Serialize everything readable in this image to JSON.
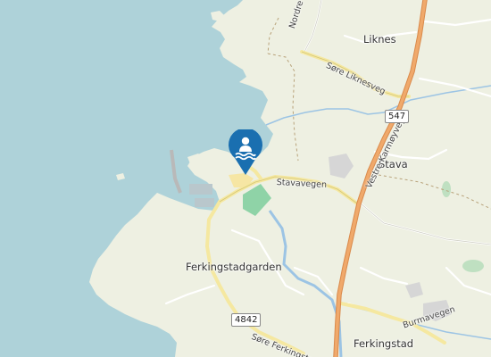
{
  "map": {
    "places": {
      "liknes": "Liknes",
      "stava": "Stava",
      "ferkingstadgarden": "Ferkingstadgarden",
      "ferkingstad": "Ferkingstad"
    },
    "roads": {
      "nordre_liknes": "Nordre Likne",
      "sore_liknesveg": "Søre Liknesveg",
      "vestre_karmoyveg": "Vestre Karmøyveg",
      "stavavegen": "Stavavegen",
      "burmavegen": "Burmavegen",
      "sore_ferkingstad": "Søre Ferkingstad"
    },
    "road_numbers": {
      "r547": "547",
      "r4842": "4842"
    },
    "marker": {
      "icon": "swimming-icon",
      "color": "#1a6fb0"
    },
    "colors": {
      "sea": "#aed2d9",
      "land": "#eef0e2",
      "main_road": "#f0a96b",
      "minor_road": "#f5e8a0",
      "water_way": "#9cc4e4",
      "park": "#8fd3a7"
    }
  }
}
